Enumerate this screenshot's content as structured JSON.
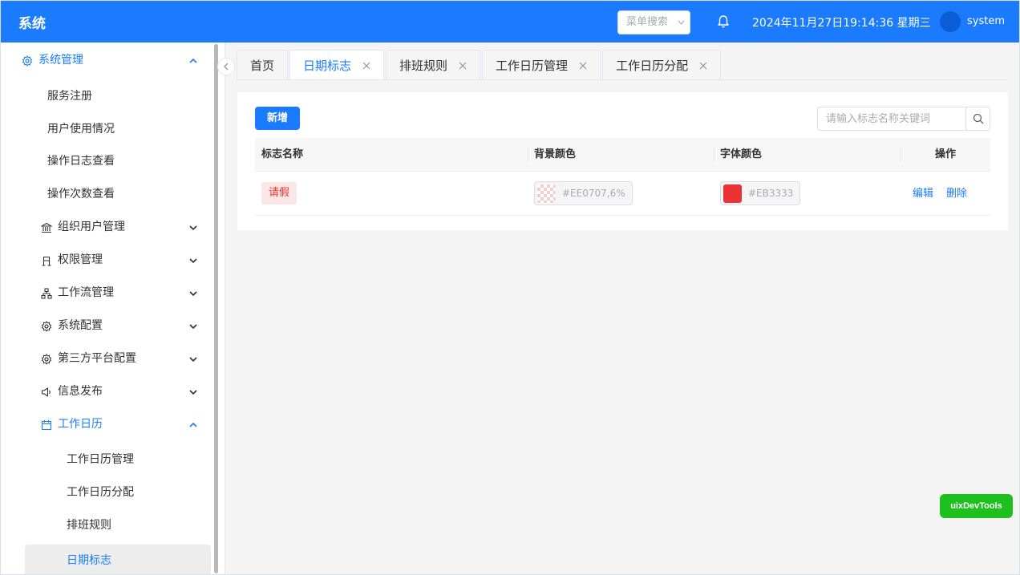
{
  "header": {
    "title": "系统",
    "menu_search_placeholder": "菜单搜索",
    "datetime": "2024年11月27日19:14:36 星期三",
    "username": "system",
    "icons": {
      "bell": "bell-icon",
      "chevron": "chevron-down-icon"
    }
  },
  "sidebar": {
    "items": [
      {
        "label": "系统管理",
        "icon": "gear-icon",
        "expanded": true
      },
      {
        "label": "服务注册"
      },
      {
        "label": "用户使用情况"
      },
      {
        "label": "操作日志查看"
      },
      {
        "label": "操作次数查看"
      },
      {
        "label": "组织用户管理",
        "icon": "bank-icon"
      },
      {
        "label": "权限管理",
        "icon": "user-icon"
      },
      {
        "label": "工作流管理",
        "icon": "sitemap-icon"
      },
      {
        "label": "系统配置",
        "icon": "gear-icon"
      },
      {
        "label": "第三方平台配置",
        "icon": "gear-icon"
      },
      {
        "label": "信息发布",
        "icon": "megaphone-icon"
      },
      {
        "label": "工作日历",
        "icon": "calendar-icon",
        "expanded": true
      },
      {
        "label": "工作日历管理"
      },
      {
        "label": "工作日历分配"
      },
      {
        "label": "排班规则"
      },
      {
        "label": "日期标志",
        "selected": true
      }
    ]
  },
  "tabs": [
    {
      "label": "首页",
      "closable": false
    },
    {
      "label": "日期标志",
      "closable": true,
      "active": true
    },
    {
      "label": "排班规则",
      "closable": true
    },
    {
      "label": "工作日历管理",
      "closable": true
    },
    {
      "label": "工作日历分配",
      "closable": true
    }
  ],
  "toolbar": {
    "add_label": "新增",
    "search_placeholder": "请输入标志名称关键词"
  },
  "table": {
    "columns": [
      "标志名称",
      "背景颜色",
      "字体颜色",
      "操作"
    ],
    "rows": [
      {
        "name": "请假",
        "bg_color": "#EE0707,6%",
        "font_color": "#EB3333",
        "actions": [
          "编辑",
          "删除"
        ]
      }
    ]
  },
  "devtools_label": "uixDevTools",
  "colors": {
    "primary": "#1a7bff",
    "tag_text": "#eb3333",
    "tag_bg": "#fde6e6",
    "font_swatch": "#eb3333",
    "devtools": "#1ec01e"
  }
}
